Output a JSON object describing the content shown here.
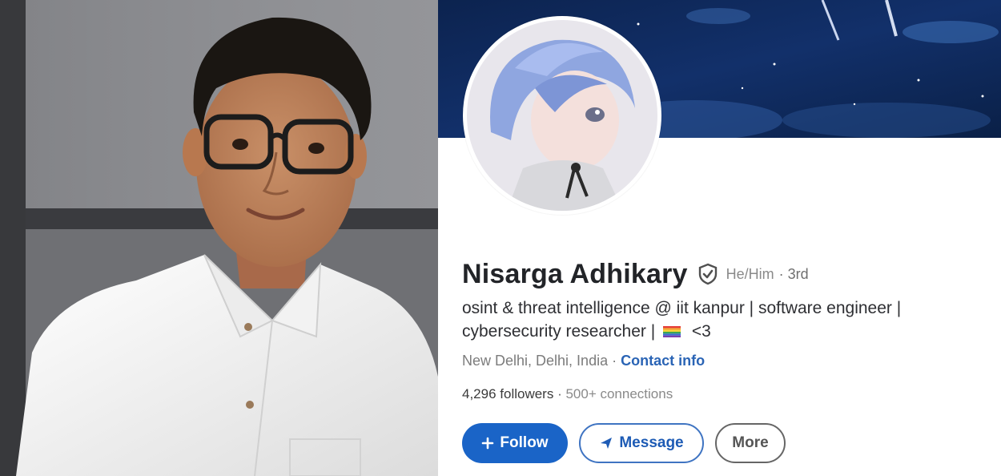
{
  "profile": {
    "name": "Nisarga Adhikary",
    "pronouns": "He/Him",
    "degree": "· 3rd",
    "headline_line1": "osint & threat intelligence @ iit kanpur | software engineer |",
    "headline_line2_prefix": "cybersecurity researcher |",
    "headline_line2_suffix": "<3",
    "location": "New Delhi, Delhi, India",
    "location_sep": " · ",
    "contact_info": "Contact info",
    "followers": "4,296 followers",
    "stats_sep": " · ",
    "connections": "500+ connections"
  },
  "actions": {
    "follow_label": "Follow",
    "message_label": "Message",
    "more_label": "More"
  },
  "icons": {
    "verify": "shield-check-icon",
    "flag": "rainbow-flag-icon",
    "follow": "plus-icon",
    "message": "send-icon"
  },
  "colors": {
    "accent": "#1a64c7",
    "link": "#2a64b5",
    "banner": "#0f2a5c"
  }
}
